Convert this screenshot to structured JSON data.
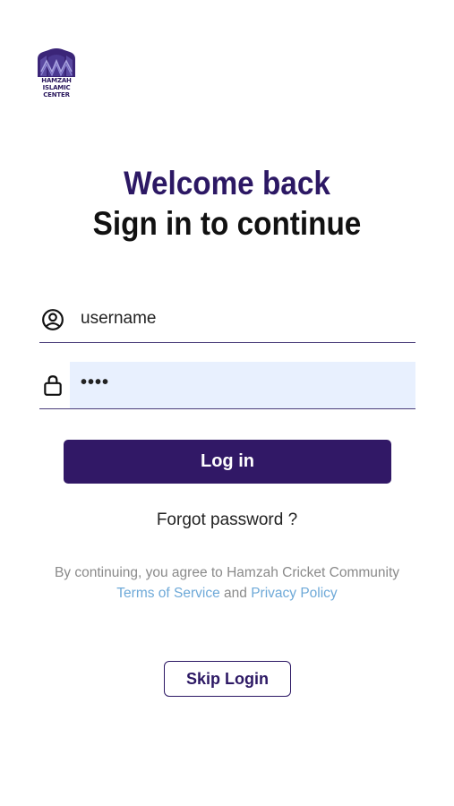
{
  "logo": {
    "line1": "HAMZAH",
    "line2": "ISLAMIC",
    "line3": "CENTER",
    "color": "#2c1a5e"
  },
  "heading": {
    "welcome": "Welcome back",
    "subtitle": "Sign in to continue"
  },
  "form": {
    "username_value": "username",
    "username_icon": "user-circle-icon",
    "password_value": "••••",
    "password_icon": "lock-icon"
  },
  "buttons": {
    "login": "Log in",
    "forgot": "Forgot password ?",
    "skip": "Skip Login"
  },
  "terms": {
    "prefix": "By continuing, you agree to Hamzah Cricket Community",
    "tos": "Terms of Service",
    "and": "and",
    "privacy": "Privacy Policy"
  },
  "colors": {
    "primary": "#311866",
    "link": "#6ea9d8",
    "autofill": "#e8f0fe"
  }
}
